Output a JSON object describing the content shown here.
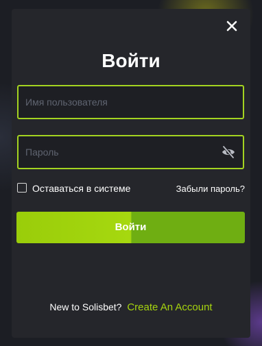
{
  "modal": {
    "title": "Войти",
    "close_icon": "close-icon",
    "username": {
      "placeholder": "Имя пользователя",
      "value": ""
    },
    "password": {
      "placeholder": "Пароль",
      "value": "",
      "toggle_icon": "eye-slash-icon"
    },
    "remember_me": {
      "label": "Оставаться в системе",
      "checked": false
    },
    "forgot_password": "Забыли пароль?",
    "login_button": "Войти",
    "signup": {
      "prompt": "New to Solisbet?",
      "link": "Create An Account"
    }
  },
  "colors": {
    "accent": "#a6d40f",
    "modal_background": "#25262b",
    "field_border": "#a4d420"
  }
}
